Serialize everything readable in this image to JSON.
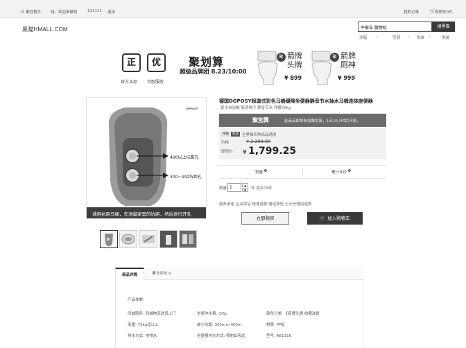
{
  "topbar": {
    "home": "聚划首页",
    "welcome": "嗨，欢迎来聚划",
    "user": "111111",
    "logout": "退出",
    "orders": "我的订单",
    "cart": "购物车0件"
  },
  "header": {
    "logo": "黑猫HMALL.COM",
    "search_value": "平衡车 腰牌机",
    "search_button": "搜黑猫",
    "hotwords": [
      "冰箱",
      "空调",
      "女装",
      "男装"
    ]
  },
  "banner": {
    "badge1": "正",
    "badge2": "优",
    "caption1": "官方正品",
    "caption2": "华耐服务",
    "title": "聚划算",
    "subtitle": "超级品牌团 8.23/10:00",
    "ad1": {
      "circle": "聚",
      "line1": "箭牌",
      "line2": "头牌",
      "price": "¥ 899"
    },
    "ad2": {
      "circle": "聚",
      "line1": "箭牌",
      "line2": "厕神",
      "price": "¥ 999"
    }
  },
  "product": {
    "image_caption": "通用抗距马桶，先测量家里的坑距，然后进行开孔",
    "annotation1": "400以上坑距孔",
    "annotation2": "300~400坑距孔",
    "brand_mark": "DGPOSY",
    "title": "德国DGPOSY超漩式彩色马桶缓降坐便器静音节水抽水马桶连体座便器",
    "subtitle": "旋水自洁釉 旋涡排污 静音节水 冲量50kg",
    "jhs_logo": "聚划算",
    "jhs_note": "此商品即将参加聚划算，1天10小时后开抢。",
    "tag_small": "平板",
    "tag_dark": "新品",
    "service_note": "全黑猫实物商品通用",
    "price_label": "价格",
    "orig_price": "¥ 2,399.00",
    "promo_label": "促销价",
    "currency": "¥",
    "promo_price": "1,799.25",
    "sales_label": "销量",
    "sales_value": "0",
    "reviews_label": "累计评价",
    "reviews_value": "0",
    "qty_label": "数量",
    "qty_value": "1",
    "stock_text": "件 库存79件",
    "service_text": "服务承诺 正品保证 极速退款 赠运费险 七天无理由退换",
    "buy_now": "立即购买",
    "add_cart": "加入购物车"
  },
  "details": {
    "tabs": [
      "商品详情",
      "累计评价 0"
    ],
    "params_title": "产品参数：",
    "params": [
      [
        "同城服务: 同城物流送货上门",
        "坐便冲水量: 3/6L",
        "颜色分类: 【箭牌头牌 收藏送原"
      ],
      [
        "承重: 70kg及以上",
        "最小坑距: 305mm 400m",
        "材质: PP板"
      ],
      [
        "排水方式: 地排水",
        "坐便器冲水方式: 喷射虹吸式",
        "型号: AB1116"
      ]
    ]
  },
  "colors": {
    "dark": "#3a3a3a",
    "jhs_bar": "#6b6b6b"
  }
}
